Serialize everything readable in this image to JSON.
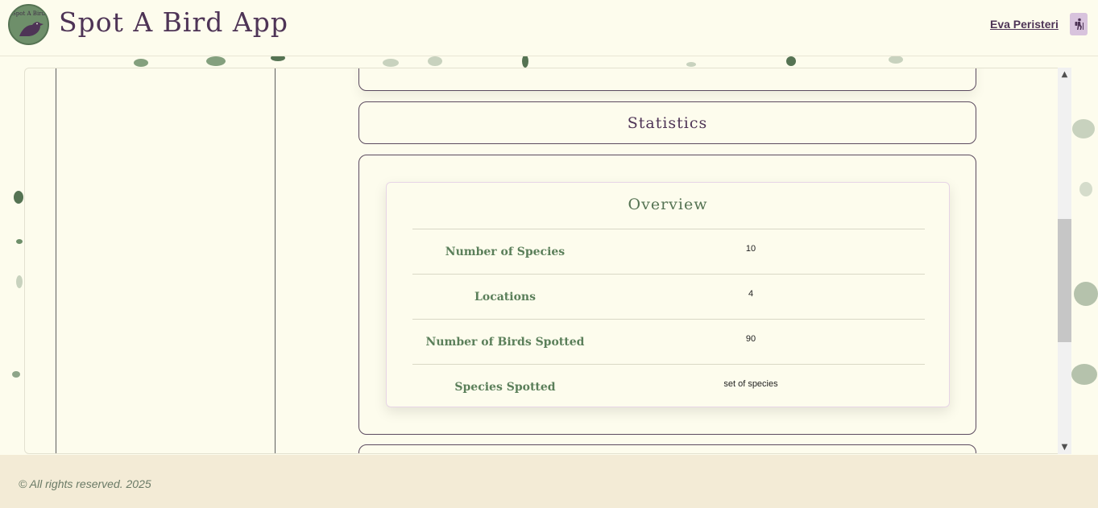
{
  "app": {
    "logo_text": "Spot A Bird",
    "title": "Spot A Bird App"
  },
  "user": {
    "name": "Eva Peristeri",
    "icon": "hiker-icon"
  },
  "sections": {
    "statistics_title": "Statistics",
    "overview_title": "Overview"
  },
  "stats": [
    {
      "label": "Number of Species",
      "value": "10"
    },
    {
      "label": "Locations",
      "value": "4"
    },
    {
      "label": "Number of Birds Spotted",
      "value": "90"
    },
    {
      "label": "Species Spotted",
      "value": "set of species"
    }
  ],
  "footer": {
    "text": "© All rights reserved. 2025"
  },
  "colors": {
    "background": "#fdfced",
    "brand_purple": "#4e3456",
    "sage_green": "#557353",
    "footer_bg": "#f3ebd6"
  }
}
